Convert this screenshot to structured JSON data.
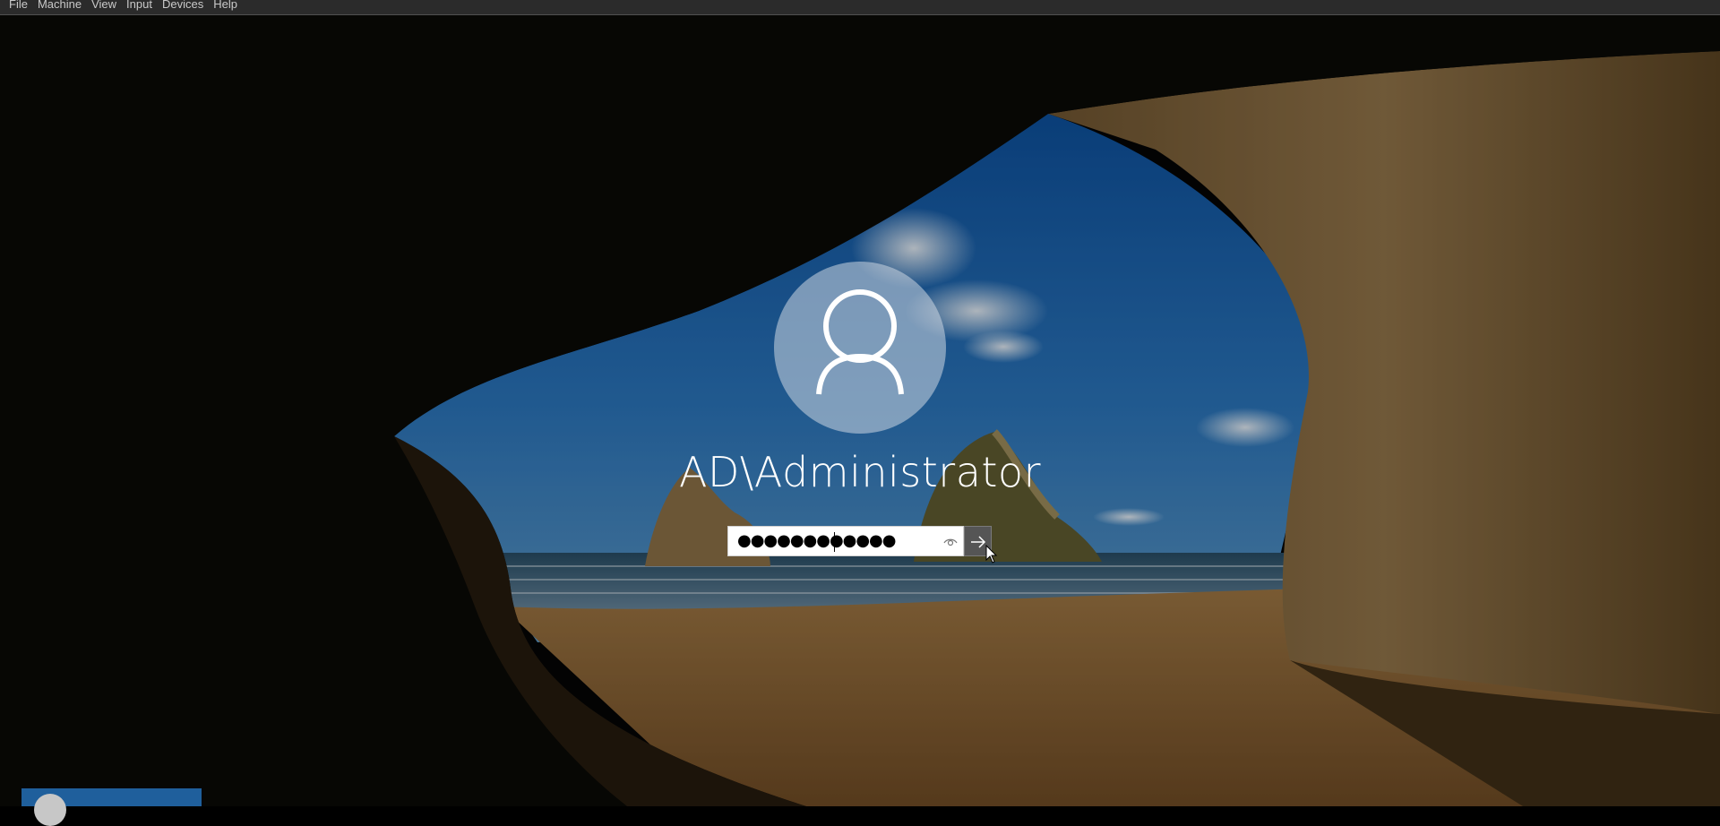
{
  "menubar": {
    "items": [
      "File",
      "Machine",
      "View",
      "Input",
      "Devices",
      "Help"
    ]
  },
  "login": {
    "username": "AD\\Administrator",
    "password_masked": "●●●●●●●●●●●●"
  },
  "icons": {
    "avatar": "user-silhouette-icon",
    "reveal": "eye-icon",
    "submit": "arrow-right-icon",
    "cursor": "mouse-pointer-icon"
  },
  "colors": {
    "menubar": "#2b2b2b",
    "submit_button": "#555555",
    "user_tile": "#1f5f9c"
  }
}
